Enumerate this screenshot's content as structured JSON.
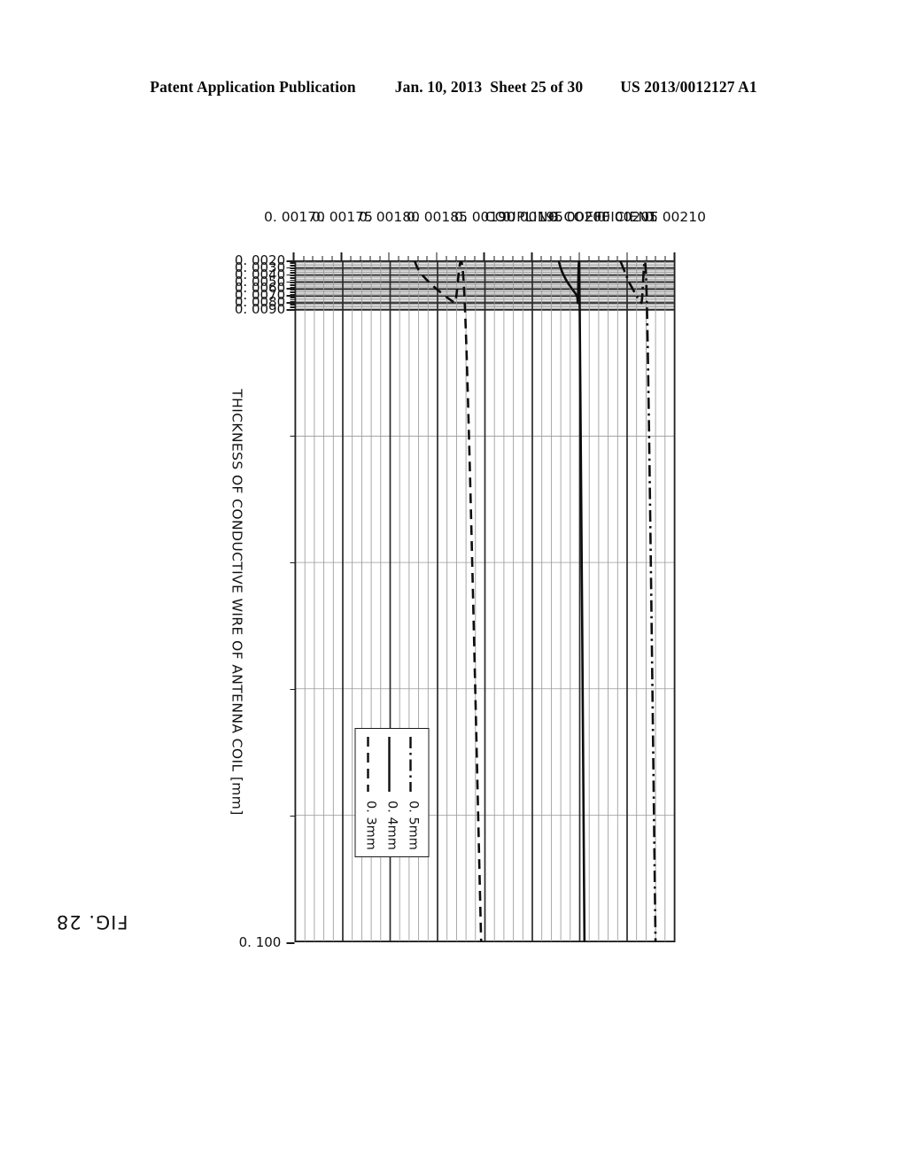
{
  "header": {
    "publication": "Patent Application Publication",
    "date": "Jan. 10, 2013",
    "sheet": "Sheet 25 of 30",
    "number": "US 2013/0012127 A1"
  },
  "figure": {
    "label": "FIG. 28"
  },
  "chart_data": {
    "type": "line",
    "title": "",
    "orientation": "rotated-90-clockwise",
    "xlabel": "THICKNESS OF CONDUCTIVE WIRE OF ANTENNA COIL [mm]",
    "ylabel": "COUPLING COEFFICIENT",
    "xlim": [
      0.002,
      0.1
    ],
    "ylim": [
      0.0017,
      0.0021
    ],
    "xticks": [
      "0. 0020",
      "0. 0030",
      "0. 0040",
      "0. 0050",
      "0. 0060",
      "0. 0070",
      "0. 0080",
      "0. 0090",
      "0. 100"
    ],
    "xtick_values": [
      0.002,
      0.003,
      0.004,
      0.005,
      0.006,
      0.007,
      0.008,
      0.009,
      0.1
    ],
    "yticks": [
      "0. 00170",
      "0. 00175",
      "0. 00180",
      "0. 00185",
      "0. 00190",
      "0. 00195",
      "0. 00200",
      "0. 00205",
      "0. 00210"
    ],
    "ytick_values": [
      0.0017,
      0.00175,
      0.0018,
      0.00185,
      0.0019,
      0.00195,
      0.002,
      0.00205,
      0.0021
    ],
    "grid": true,
    "grid_minor": true,
    "legend_position": "lower-right",
    "series": [
      {
        "name": "0. 5mm",
        "style": "dashdot",
        "x": [
          0.002,
          0.003,
          0.004,
          0.005,
          0.006,
          0.007,
          0.008,
          0.009,
          0.1
        ],
        "values": [
          0.002043,
          0.002046,
          0.002049,
          0.002052,
          0.002056,
          0.00206,
          0.002065,
          0.002071,
          0.00208
        ]
      },
      {
        "name": "0. 4mm",
        "style": "solid",
        "x": [
          0.002,
          0.003,
          0.004,
          0.005,
          0.006,
          0.007,
          0.008,
          0.009,
          0.1
        ],
        "values": [
          0.001978,
          0.00198,
          0.001983,
          0.001987,
          0.001992,
          0.001997,
          0.001998,
          0.002,
          0.002005
        ]
      },
      {
        "name": "0. 3mm",
        "style": "dashed",
        "x": [
          0.002,
          0.003,
          0.004,
          0.005,
          0.006,
          0.007,
          0.008,
          0.009,
          0.1
        ],
        "values": [
          0.001826,
          0.001829,
          0.001834,
          0.001841,
          0.001849,
          0.001858,
          0.001868,
          0.001879,
          0.001896
        ]
      }
    ]
  },
  "legend": {
    "entries": [
      {
        "label": "0. 5mm",
        "style": "dashdot"
      },
      {
        "label": "0. 4mm",
        "style": "solid"
      },
      {
        "label": "0. 3mm",
        "style": "dashed"
      }
    ]
  }
}
